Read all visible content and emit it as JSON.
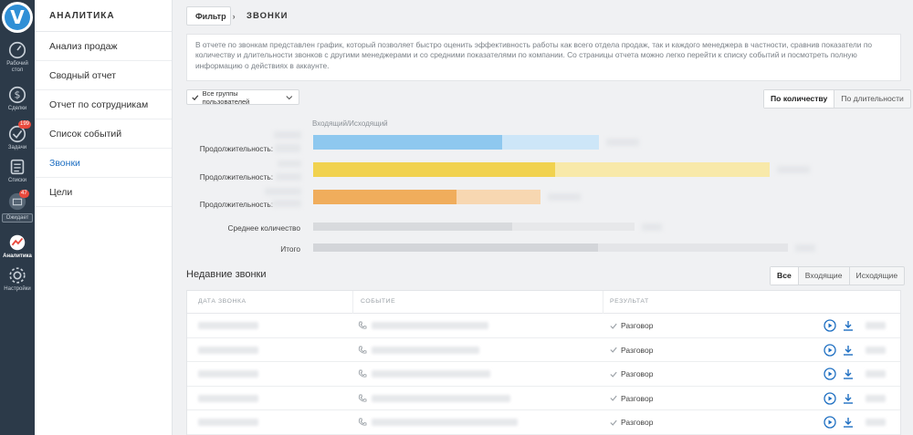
{
  "rail": {
    "items": [
      {
        "label_l1": "Рабочий",
        "label_l2": "стол",
        "icon": "speedometer-icon"
      },
      {
        "label_l1": "Сделки",
        "label_l2": "",
        "icon": "dollar-icon"
      },
      {
        "label_l1": "Задачи",
        "label_l2": "",
        "icon": "check-circle-icon",
        "badge": "199"
      },
      {
        "label_l1": "Списки",
        "label_l2": "",
        "icon": "list-icon"
      },
      {
        "label_l1": "",
        "label_l2": "",
        "icon": "mail-icon",
        "badge": "47"
      },
      {
        "label_l1": "Аналитика",
        "label_l2": "",
        "icon": "analytics-icon"
      },
      {
        "label_l1": "Настройки",
        "label_l2": "",
        "icon": "gear-icon"
      }
    ],
    "mini_button": "Ожидает"
  },
  "sidebar": {
    "title": "АНАЛИТИКА",
    "items": [
      {
        "label": "Анализ продаж"
      },
      {
        "label": "Сводный отчет"
      },
      {
        "label": "Отчет по сотрудникам"
      },
      {
        "label": "Список событий"
      },
      {
        "label": "Звонки"
      },
      {
        "label": "Цели"
      }
    ],
    "active_index": 4
  },
  "topbar": {
    "filter_label": "Фильтр",
    "page_title": "ЗВОНКИ"
  },
  "info_text": "В отчете по звонкам представлен график, который позволяет быстро оценить эффективность работы как всего отдела продаж, так и каждого менеджера в частности, сравнив показатели по количеству и длительности звонков с другими менеджерами и со средними показателями по компании. Со страницы отчета можно легко перейти к списку событий и посмотреть полную информацию о действиях в аккаунте.",
  "group_select": {
    "value": "Все группы пользователей"
  },
  "mode_toggle": {
    "options": [
      "По количеству",
      "По длительности"
    ],
    "active": 0
  },
  "chart": {
    "legend": "Входящий/Исходящий",
    "rows": [
      {
        "label": "Продолжительность:",
        "color": "#8ec8ef",
        "light": "#cde6f8",
        "strong_frac": 0.66,
        "total_frac": 1.0
      },
      {
        "label": "Продолжительность:",
        "color": "#f1d24f",
        "light": "#f8e9a9",
        "strong_frac": 0.53,
        "total_frac": 1.0
      },
      {
        "label": "Продолжительность:",
        "color": "#f0ad5c",
        "light": "#f7d7b1",
        "strong_frac": 0.63,
        "total_frac": 1.0
      },
      {
        "label": "Среднее количество",
        "color": "#d8dadd",
        "light": "#e7e8ea",
        "strong_frac": 0.62,
        "total_frac": 1.0
      },
      {
        "label": "Итого",
        "color": "#d3d5d9",
        "light": "#e4e5e8",
        "strong_frac": 0.6,
        "total_frac": 1.0
      }
    ]
  },
  "recent": {
    "title": "Недавние звонки",
    "tabs": [
      "Все",
      "Входящие",
      "Исходящие"
    ],
    "active_tab": 0,
    "columns": [
      "ДАТА ЗВОНКА",
      "СОБЫТИЕ",
      "РЕЗУЛЬТАТ"
    ],
    "rows": [
      {
        "result": "Разговор"
      },
      {
        "result": "Разговор"
      },
      {
        "result": "Разговор"
      },
      {
        "result": "Разговор"
      },
      {
        "result": "Разговор"
      }
    ]
  },
  "colors": {
    "rail_bg": "#2c3a49",
    "accent": "#1e6fc2",
    "badge": "#e8493d"
  }
}
